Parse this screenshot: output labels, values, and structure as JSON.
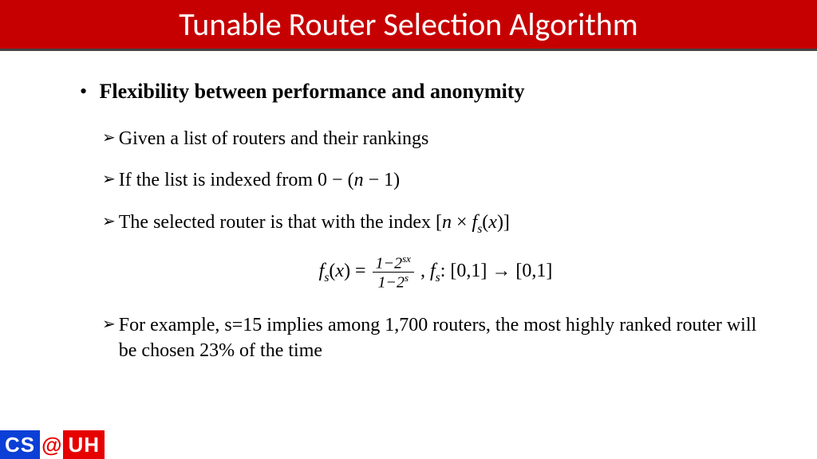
{
  "title": "Tunable Router Selection Algorithm",
  "main_bullet": "Flexibility between performance and anonymity",
  "items": {
    "a": "Given a list of routers and their rankings",
    "b_prefix": "If the list is indexed from ",
    "b_math": "0 − (n − 1)",
    "c_prefix": "The selected router is that with the index ",
    "c_math": "[n × f_s(x)]",
    "d": "For example, s=15 implies among 1,700 routers, the most highly ranked router will be chosen 23% of the time"
  },
  "formula": {
    "lhs": "f_s(x) = ",
    "num": "1 − 2^{sx}",
    "den": "1 − 2^{s}",
    "tail": ", f_s: [0,1] → [0,1]"
  },
  "logo": {
    "cs": "CS",
    "at": "@",
    "uh": "UH"
  }
}
